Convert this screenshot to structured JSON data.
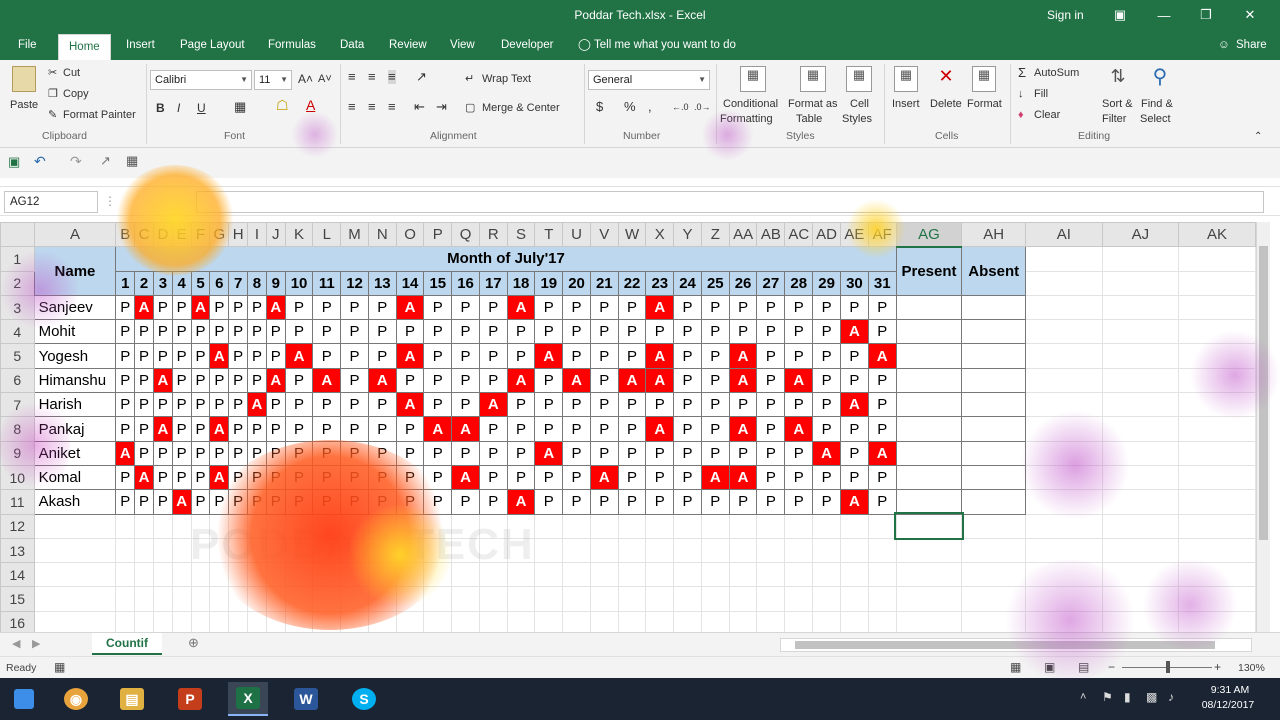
{
  "window": {
    "title": "Poddar Tech.xlsx - Excel",
    "signin": "Sign in",
    "share": "Share"
  },
  "tabs": [
    "File",
    "Home",
    "Insert",
    "Page Layout",
    "Formulas",
    "Data",
    "Review",
    "View",
    "Developer"
  ],
  "tellme": "Tell me what you want to do",
  "ribbon": {
    "clipboard": {
      "group": "Clipboard",
      "paste": "Paste",
      "cut": "Cut",
      "copy": "Copy",
      "format_painter": "Format Painter"
    },
    "font": {
      "group": "Font",
      "name": "Calibri",
      "size": "11",
      "bold": "B",
      "italic": "I",
      "underline": "U"
    },
    "alignment": {
      "group": "Alignment",
      "wrap": "Wrap Text",
      "merge": "Merge & Center"
    },
    "number": {
      "group": "Number",
      "format": "General",
      "currency": "$",
      "percent": "%",
      "comma": ","
    },
    "styles": {
      "group": "Styles",
      "conditional": "Conditional",
      "conditional2": "Formatting",
      "format_table": "Format as",
      "format_table2": "Table",
      "cell_styles": "Cell",
      "cell_styles2": "Styles"
    },
    "cells": {
      "group": "Cells",
      "insert": "Insert",
      "delete": "Delete",
      "format": "Format"
    },
    "editing": {
      "group": "Editing",
      "autosum": "AutoSum",
      "fill": "Fill",
      "clear": "Clear",
      "sort": "Sort &",
      "sort2": "Filter",
      "find": "Find &",
      "find2": "Select"
    }
  },
  "namebox": "AG12",
  "columns": [
    "A",
    "B",
    "C",
    "D",
    "E",
    "F",
    "G",
    "H",
    "I",
    "J",
    "K",
    "L",
    "M",
    "N",
    "O",
    "P",
    "Q",
    "R",
    "S",
    "T",
    "U",
    "V",
    "W",
    "X",
    "Y",
    "Z",
    "AA",
    "AB",
    "AC",
    "AD",
    "AE",
    "AF",
    "AG",
    "AH",
    "AI",
    "AJ",
    "AK"
  ],
  "selected_column": "AG",
  "sheet": {
    "header_name": "Name",
    "header_month": "Month of July'17",
    "header_present": "Present",
    "header_absent": "Absent",
    "days": [
      "1",
      "2",
      "3",
      "4",
      "5",
      "6",
      "7",
      "8",
      "9",
      "10",
      "11",
      "12",
      "13",
      "14",
      "15",
      "16",
      "17",
      "18",
      "19",
      "20",
      "21",
      "22",
      "23",
      "24",
      "25",
      "26",
      "27",
      "28",
      "29",
      "30",
      "31"
    ],
    "rows": [
      {
        "name": "Sanjeev",
        "days": [
          "P",
          "A",
          "P",
          "P",
          "A",
          "P",
          "P",
          "P",
          "A",
          "P",
          "P",
          "P",
          "P",
          "A",
          "P",
          "P",
          "P",
          "A",
          "P",
          "P",
          "P",
          "P",
          "A",
          "P",
          "P",
          "P",
          "P",
          "P",
          "P",
          "P",
          "P"
        ]
      },
      {
        "name": "Mohit",
        "days": [
          "P",
          "P",
          "P",
          "P",
          "P",
          "P",
          "P",
          "P",
          "P",
          "P",
          "P",
          "P",
          "P",
          "P",
          "P",
          "P",
          "P",
          "P",
          "P",
          "P",
          "P",
          "P",
          "P",
          "P",
          "P",
          "P",
          "P",
          "P",
          "P",
          "A",
          "P"
        ]
      },
      {
        "name": "Yogesh",
        "days": [
          "P",
          "P",
          "P",
          "P",
          "P",
          "A",
          "P",
          "P",
          "P",
          "A",
          "P",
          "P",
          "P",
          "A",
          "P",
          "P",
          "P",
          "P",
          "A",
          "P",
          "P",
          "P",
          "A",
          "P",
          "P",
          "A",
          "P",
          "P",
          "P",
          "P",
          "A"
        ]
      },
      {
        "name": "Himanshu",
        "days": [
          "P",
          "P",
          "A",
          "P",
          "P",
          "P",
          "P",
          "P",
          "A",
          "P",
          "A",
          "P",
          "A",
          "P",
          "P",
          "P",
          "P",
          "A",
          "P",
          "A",
          "P",
          "A",
          "A",
          "P",
          "P",
          "A",
          "P",
          "A",
          "P",
          "P",
          "P"
        ]
      },
      {
        "name": "Harish",
        "days": [
          "P",
          "P",
          "P",
          "P",
          "P",
          "P",
          "P",
          "A",
          "P",
          "P",
          "P",
          "P",
          "P",
          "A",
          "P",
          "P",
          "A",
          "P",
          "P",
          "P",
          "P",
          "P",
          "P",
          "P",
          "P",
          "P",
          "P",
          "P",
          "P",
          "A",
          "P"
        ]
      },
      {
        "name": "Pankaj",
        "days": [
          "P",
          "P",
          "A",
          "P",
          "P",
          "A",
          "P",
          "P",
          "P",
          "P",
          "P",
          "P",
          "P",
          "P",
          "A",
          "A",
          "P",
          "P",
          "P",
          "P",
          "P",
          "P",
          "A",
          "P",
          "P",
          "A",
          "P",
          "A",
          "P",
          "P",
          "P"
        ]
      },
      {
        "name": "Aniket",
        "days": [
          "A",
          "P",
          "P",
          "P",
          "P",
          "P",
          "P",
          "P",
          "P",
          "P",
          "P",
          "P",
          "P",
          "P",
          "P",
          "P",
          "P",
          "P",
          "A",
          "P",
          "P",
          "P",
          "P",
          "P",
          "P",
          "P",
          "P",
          "P",
          "A",
          "P",
          "A"
        ]
      },
      {
        "name": "Komal",
        "days": [
          "P",
          "A",
          "P",
          "P",
          "P",
          "A",
          "P",
          "P",
          "P",
          "P",
          "P",
          "P",
          "P",
          "P",
          "P",
          "A",
          "P",
          "P",
          "P",
          "P",
          "A",
          "P",
          "P",
          "P",
          "A",
          "A",
          "P",
          "P",
          "P",
          "P",
          "P"
        ]
      },
      {
        "name": "Akash",
        "days": [
          "P",
          "P",
          "P",
          "A",
          "P",
          "P",
          "P",
          "P",
          "P",
          "P",
          "P",
          "P",
          "P",
          "P",
          "P",
          "P",
          "P",
          "A",
          "P",
          "P",
          "P",
          "P",
          "P",
          "P",
          "P",
          "P",
          "P",
          "P",
          "P",
          "A",
          "P"
        ]
      }
    ]
  },
  "sheet_tab": "Countif",
  "status": {
    "ready": "Ready",
    "zoom": "130%"
  },
  "taskbar": {
    "time": "9:31 AM",
    "date": "08/12/2017"
  },
  "watermark": "PODDAR TECH",
  "colors": {
    "excel_green": "#217346",
    "absent_red": "#ff0000",
    "header_blue": "#bdd7ee"
  }
}
